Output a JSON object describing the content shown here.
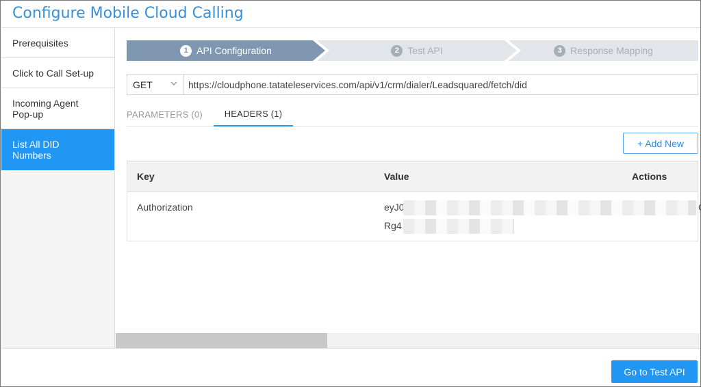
{
  "header": {
    "title": "Configure Mobile Cloud Calling"
  },
  "sidebar": {
    "items": [
      {
        "label": "Prerequisites",
        "active": false
      },
      {
        "label": "Click to Call Set-up",
        "active": false
      },
      {
        "label": "Incoming Agent Pop-up",
        "active": false
      },
      {
        "label": "List All DID Numbers",
        "active": true
      }
    ]
  },
  "steps": [
    {
      "number": "1",
      "label": "API Configuration",
      "state": "active"
    },
    {
      "number": "2",
      "label": "Test API",
      "state": "inactive"
    },
    {
      "number": "3",
      "label": "Response Mapping",
      "state": "inactive"
    }
  ],
  "request": {
    "method": "GET",
    "url": "https://cloudphone.tatateleservices.com/api/v1/crm/dialer/Leadsquared/fetch/did"
  },
  "tabs": [
    {
      "label": "PARAMETERS (0)",
      "active": false
    },
    {
      "label": "HEADERS (1)",
      "active": true
    }
  ],
  "add_new_label": "+ Add New",
  "table": {
    "columns": [
      "Key",
      "Value",
      "Actions"
    ],
    "rows": [
      {
        "key": "Authorization",
        "value_line1": "eyJ0",
        "value_line2": "Rg4",
        "value_trail": "C"
      }
    ]
  },
  "footer": {
    "go_button_label": "Go to Test API"
  },
  "colors": {
    "accent": "#2196f3",
    "step_active": "#8097b1",
    "step_inactive": "#e2e6ea",
    "title": "#3a8fd9"
  }
}
